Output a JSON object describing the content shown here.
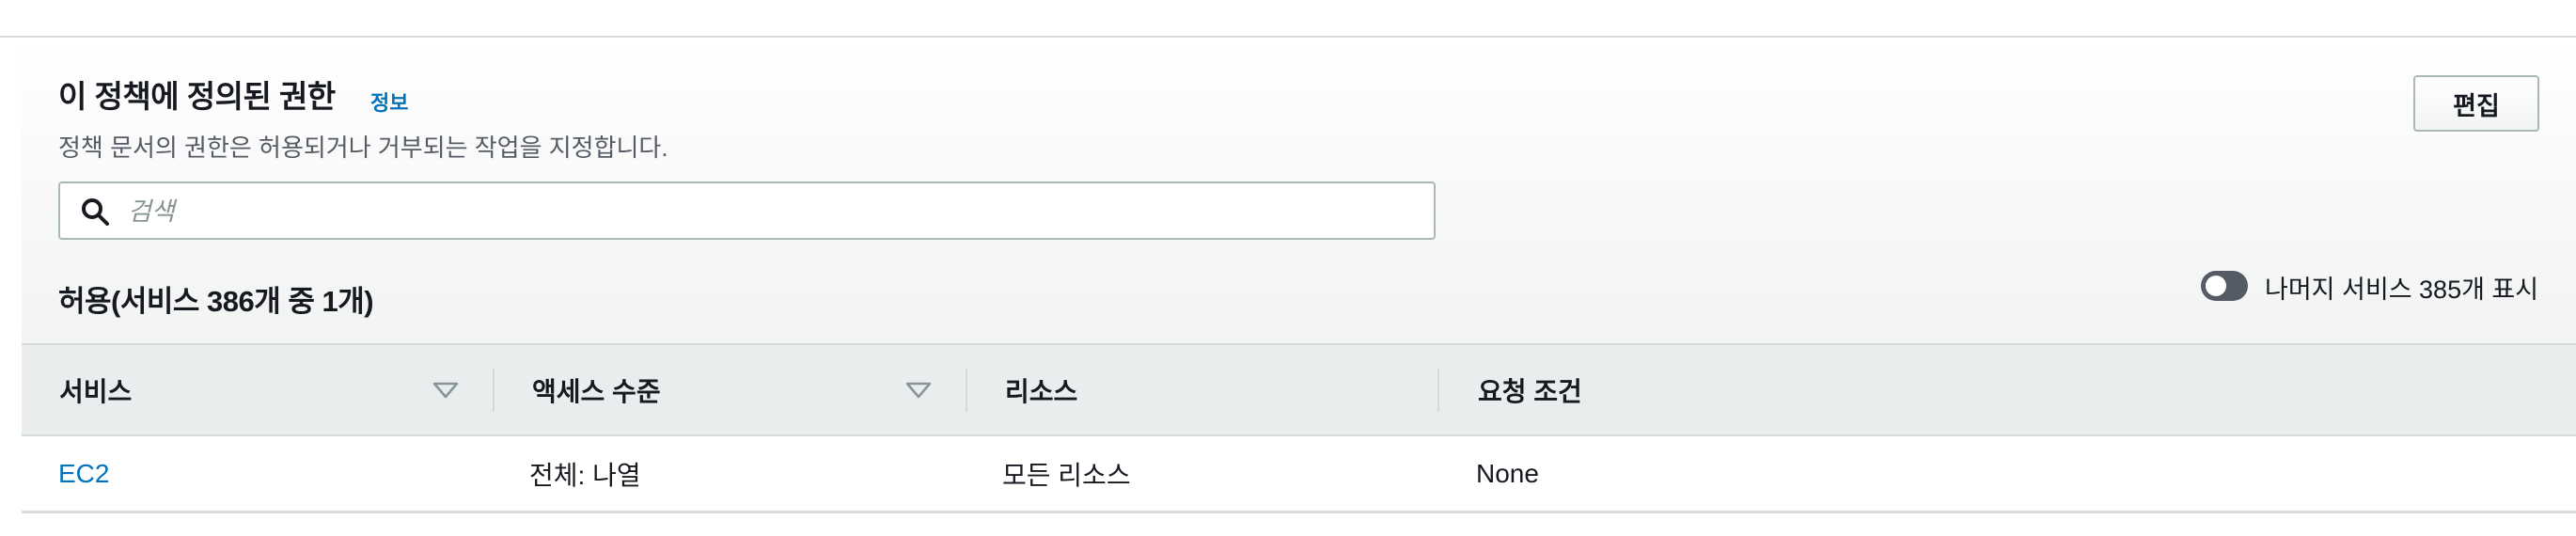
{
  "policy_permissions": {
    "title": "이 정책에 정의된 권한",
    "info_link": "정보",
    "description": "정책 문서의 권한은 허용되거나 거부되는 작업을 지정합니다.",
    "edit_label": "편집",
    "search": {
      "placeholder": "검색",
      "value": ""
    },
    "allowed_heading": "허용(서비스 386개 중 1개)",
    "toggle": {
      "label": "나머지 서비스 385개 표시",
      "enabled": false
    },
    "table": {
      "columns": [
        "서비스",
        "액세스 수준",
        "리소스",
        "요청 조건"
      ],
      "rows": [
        [
          "EC2",
          "전체: 나열",
          "모든 리소스",
          "None"
        ]
      ]
    }
  },
  "colors": {
    "link": "#0073bb",
    "text": "#16191f",
    "secondary_text": "#545b64",
    "border": "#d5dbdb",
    "toggle_off": "#545b64"
  },
  "icons": {
    "search": "search-icon",
    "sort": "sort-triangle-icon"
  }
}
